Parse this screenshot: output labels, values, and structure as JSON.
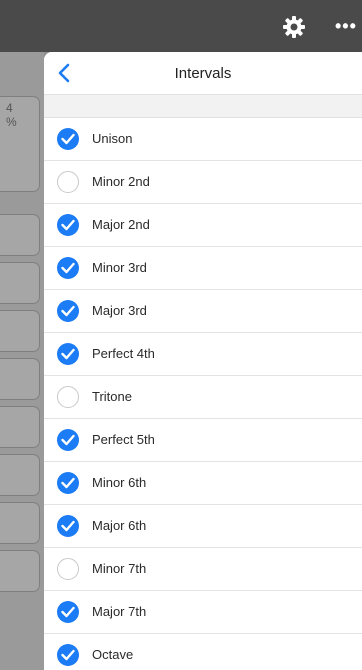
{
  "popover": {
    "title": "Intervals",
    "back_label": "Back"
  },
  "background": {
    "card_fragment": "4\n%"
  },
  "colors": {
    "accent": "#1c7cf5",
    "topbar": "#4a4a4a"
  },
  "intervals": [
    {
      "label": "Unison",
      "checked": true
    },
    {
      "label": "Minor 2nd",
      "checked": false
    },
    {
      "label": "Major 2nd",
      "checked": true
    },
    {
      "label": "Minor 3rd",
      "checked": true
    },
    {
      "label": "Major 3rd",
      "checked": true
    },
    {
      "label": "Perfect 4th",
      "checked": true
    },
    {
      "label": "Tritone",
      "checked": false
    },
    {
      "label": "Perfect 5th",
      "checked": true
    },
    {
      "label": "Minor 6th",
      "checked": true
    },
    {
      "label": "Major 6th",
      "checked": true
    },
    {
      "label": "Minor 7th",
      "checked": false
    },
    {
      "label": "Major 7th",
      "checked": true
    },
    {
      "label": "Octave",
      "checked": true
    }
  ]
}
